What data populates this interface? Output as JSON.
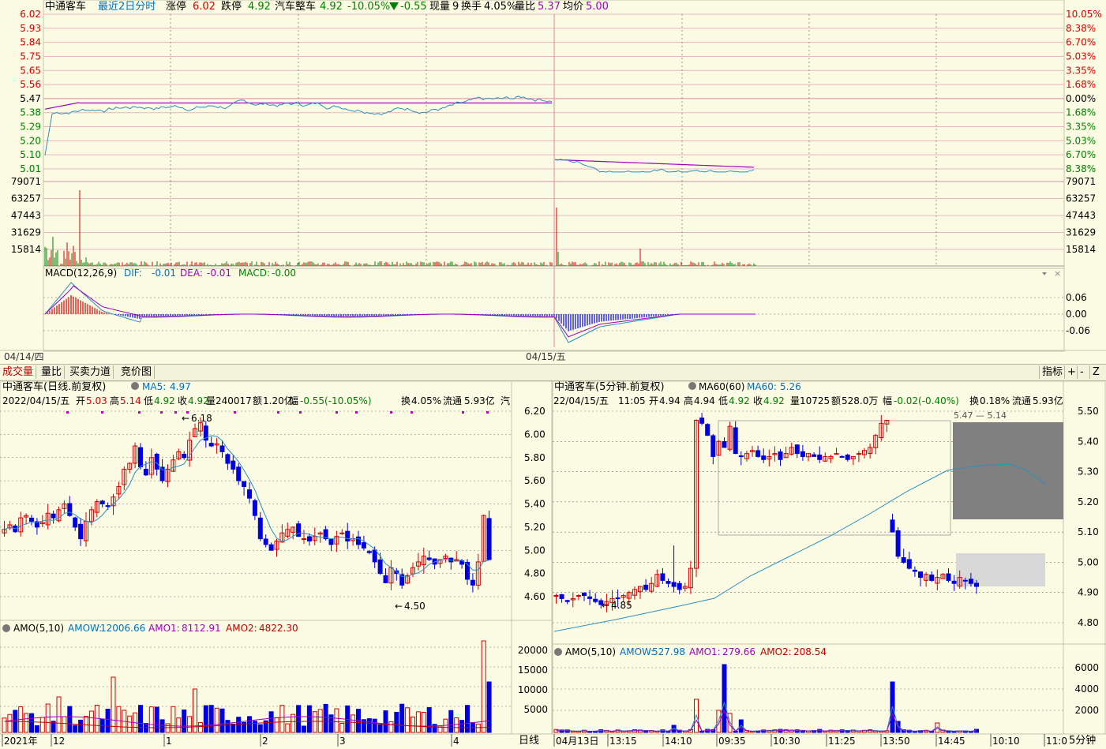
{
  "intraday": {
    "name": "中通客车",
    "mode": "最近2日分时",
    "limit_up_label": "涨停",
    "limit_up": "6.02",
    "limit_down_label": "跌停",
    "limit_down": "4.92",
    "sector": "汽车整车",
    "last": "4.92",
    "pct": "-10.05%",
    "change": "-0.55",
    "vol_label": "现量",
    "vol": "9",
    "turnover_label": "换手",
    "turnover": "4.05%",
    "vratio_label": "量比",
    "vratio": "5.37",
    "avg_label": "均价",
    "avg": "5.00",
    "price_ticks": [
      "6.02",
      "5.93",
      "5.84",
      "5.75",
      "5.65",
      "5.56",
      "5.47",
      "5.38",
      "5.29",
      "5.20",
      "5.10",
      "5.01"
    ],
    "pct_ticks": [
      "10.05%",
      "8.38%",
      "6.70%",
      "5.03%",
      "3.35%",
      "1.68%",
      "0.00%",
      "1.68%",
      "3.35%",
      "5.03%",
      "6.70%",
      "8.38%"
    ],
    "vol_ticks": [
      "79071",
      "63257",
      "47443",
      "31629",
      "15814"
    ],
    "macd_ticks": [
      "0.06",
      "0.00",
      "-0.06"
    ],
    "macd_legend": {
      "name": "MACD(12,26,9)",
      "dif_label": "DIF:",
      "dif": "-0.01",
      "dea_label": "DEA:",
      "dea": "-0.01",
      "macd_label": "MACD:",
      "macd": "-0.00"
    },
    "date_labels": [
      "04/14/四",
      "04/15/五"
    ]
  },
  "tabs": [
    "成交量",
    "量比",
    "买卖力道",
    "竞价图"
  ],
  "tools": [
    "指标",
    "+",
    "-",
    "Z"
  ],
  "daily": {
    "title": "中通客车(日线.前复权)",
    "ma_label": "MA5:",
    "ma_value": "4.97",
    "info": {
      "date": "2022/04/15/五",
      "open_label": "开",
      "open": "5.03",
      "high_label": "高",
      "high": "5.14",
      "low_label": "低",
      "low": "4.92",
      "close_label": "收",
      "close": "4.92",
      "vol_label": "量",
      "vol": "240017",
      "amt_label": "额",
      "amt": "1.20亿",
      "range_label": "幅",
      "range": "-0.55(-10.05%)",
      "turn_label": "换",
      "turn": "4.05%",
      "float_label": "流通",
      "float": "5.93亿",
      "extra": "汽"
    },
    "price_ticks": [
      "6.20",
      "6.00",
      "5.80",
      "5.60",
      "5.40",
      "5.20",
      "5.00",
      "4.80",
      "4.60"
    ],
    "high_mark": "6.18",
    "low_mark": "4.50",
    "amo_legend": {
      "name": "AMO(5,10)",
      "amow_label": "AMOW:",
      "amow": "12006.66",
      "amo1_label": "AMO1:",
      "amo1": "8112.91",
      "amo2_label": "AMO2:",
      "amo2": "4822.30"
    },
    "amo_ticks": [
      "20000",
      "15000",
      "10000",
      "5000"
    ],
    "date_axis": [
      "2021年",
      "12",
      "1",
      "2",
      "3",
      "4"
    ],
    "period": "日线"
  },
  "m5": {
    "title": "中通客车(5分钟.前复权)",
    "ma_legend_name": "MA60(60)",
    "ma_label": "MA60:",
    "ma_value": "5.26",
    "info": {
      "date": "22/04/15/五",
      "time": "11:05",
      "open_label": "开",
      "open": "4.94",
      "high_label": "高",
      "high": "4.94",
      "low_label": "低",
      "low": "4.92",
      "close_label": "收",
      "close": "4.92",
      "vol_label": "量",
      "vol": "10725",
      "amt_label": "额",
      "amt": "528.0万",
      "range_label": "幅",
      "range": "-0.02(-0.40%)",
      "turn_label": "换",
      "turn": "0.18%",
      "float_label": "流通",
      "float": "5.93亿"
    },
    "price_ticks": [
      "5.50",
      "5.40",
      "5.30",
      "5.20",
      "5.10",
      "5.00",
      "4.90",
      "4.80"
    ],
    "low_mark": "4.85",
    "top_mark": "5.47 — 5.14",
    "amo_legend": {
      "name": "AMO(5,10)",
      "amow_label": "AMOW:",
      "amow": "527.98",
      "amo1_label": "AMO1:",
      "amo1": "279.66",
      "amo2_label": "AMO2:",
      "amo2": "208.54"
    },
    "amo_ticks": [
      "6000",
      "4000",
      "2000"
    ],
    "time_axis": [
      "04月13日",
      "13:15",
      "14:10",
      "09:35",
      "10:30",
      "11:25",
      "13:50",
      "14:45",
      "10:10",
      "11:0"
    ],
    "period": "5分钟"
  },
  "colors": {
    "up": "#d40000",
    "down": "#0000e0",
    "price_line": "#2b8fc0",
    "avg_line": "#a000c0",
    "macd_green": "#008000",
    "grid": "#c4c4ac"
  }
}
